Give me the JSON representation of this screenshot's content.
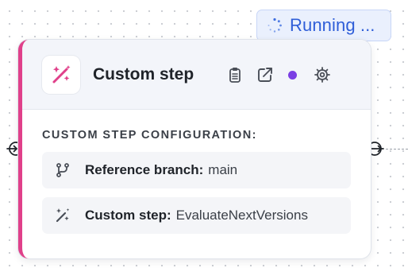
{
  "status": {
    "label": "Running ...",
    "icon": "spinner-icon",
    "color": "#2f5ed8"
  },
  "node": {
    "title": "Custom step",
    "icon": "magic-wand-icon",
    "accent_color": "#e0408a",
    "status_dot_color": "#7b3fe4",
    "actions": [
      {
        "name": "clipboard-icon"
      },
      {
        "name": "external-link-icon"
      },
      {
        "name": "status-dot"
      },
      {
        "name": "gear-icon"
      }
    ]
  },
  "config": {
    "heading": "CUSTOM STEP CONFIGURATION:",
    "rows": [
      {
        "icon": "git-branch-icon",
        "label": "Reference branch:",
        "value": "main"
      },
      {
        "icon": "magic-wand-icon",
        "label": "Custom step:",
        "value": "EvaluateNextVersions"
      }
    ]
  }
}
